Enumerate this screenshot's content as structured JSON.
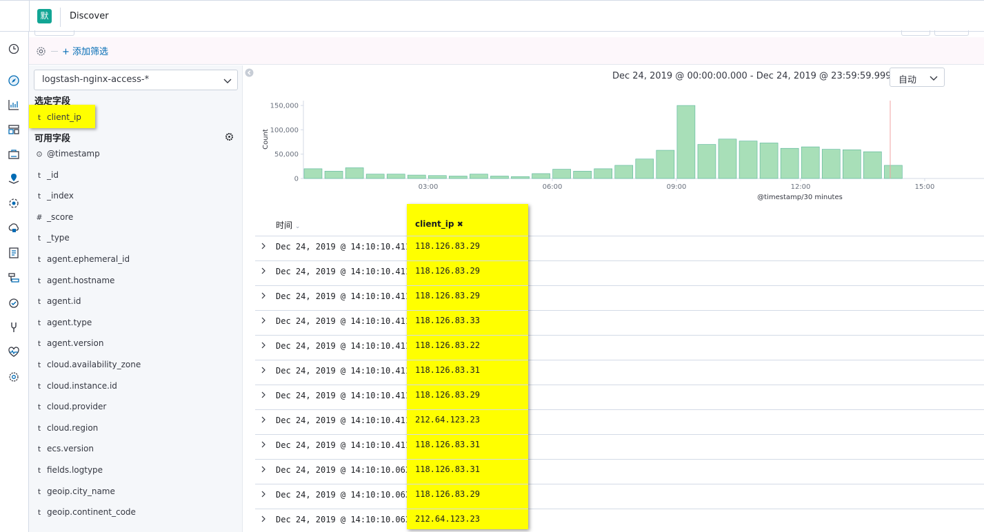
{
  "header": {
    "logo_char": "默",
    "title": "Discover"
  },
  "filter_bar": {
    "add_filter_label": "+ 添加筛选"
  },
  "sidebar": {
    "index_pattern": "logstash-nginx-access-*",
    "selected_title": "选定字段",
    "selected_fields": [
      {
        "type": "t",
        "name": "client_ip"
      }
    ],
    "available_title": "可用字段",
    "available_fields": [
      {
        "type": "⊙",
        "name": "@timestamp"
      },
      {
        "type": "t",
        "name": "_id"
      },
      {
        "type": "t",
        "name": "_index"
      },
      {
        "type": "#",
        "name": "_score"
      },
      {
        "type": "t",
        "name": "_type"
      },
      {
        "type": "t",
        "name": "agent.ephemeral_id"
      },
      {
        "type": "t",
        "name": "agent.hostname"
      },
      {
        "type": "t",
        "name": "agent.id"
      },
      {
        "type": "t",
        "name": "agent.type"
      },
      {
        "type": "t",
        "name": "agent.version"
      },
      {
        "type": "t",
        "name": "cloud.availability_zone"
      },
      {
        "type": "t",
        "name": "cloud.instance.id"
      },
      {
        "type": "t",
        "name": "cloud.provider"
      },
      {
        "type": "t",
        "name": "cloud.region"
      },
      {
        "type": "t",
        "name": "ecs.version"
      },
      {
        "type": "t",
        "name": "fields.logtype"
      },
      {
        "type": "t",
        "name": "geoip.city_name"
      },
      {
        "type": "t",
        "name": "geoip.continent_code"
      }
    ]
  },
  "main": {
    "time_range": "Dec 24, 2019 @ 00:00:00.000 - Dec 24, 2019 @ 23:59:59.999 —",
    "interval": "自动"
  },
  "chart_data": {
    "type": "bar",
    "xlabel": "@timestamp/30 minutes",
    "ylabel": "Count",
    "x_ticks": [
      "03:00",
      "06:00",
      "09:00",
      "12:00",
      "15:00"
    ],
    "y_ticks": [
      "0",
      "50,000",
      "100,000",
      "150,000"
    ],
    "ylim": [
      0,
      160000
    ],
    "x": [
      "00:30",
      "01:00",
      "01:30",
      "02:00",
      "02:30",
      "03:00",
      "03:30",
      "04:00",
      "04:30",
      "05:00",
      "05:30",
      "06:00",
      "06:30",
      "07:00",
      "07:30",
      "08:00",
      "08:30",
      "09:00",
      "09:30",
      "10:00",
      "10:30",
      "11:00",
      "11:30",
      "12:00",
      "12:30",
      "13:00",
      "13:30",
      "14:00"
    ],
    "values": [
      20000,
      15000,
      22000,
      9000,
      9000,
      7000,
      6000,
      5000,
      9000,
      5000,
      4000,
      10000,
      19000,
      15000,
      20000,
      27000,
      40000,
      58000,
      150000,
      70000,
      81000,
      77000,
      73000,
      62000,
      65000,
      60000,
      59000,
      55000,
      27000
    ],
    "bar_color": "#a8dfb8",
    "bar_stroke": "#54b399",
    "now_marker_color": "#f2a1a1",
    "grid": false
  },
  "table": {
    "time_header": "时间",
    "ip_header": "client_ip",
    "rows": [
      {
        "time": "Dec 24, 2019 @ 14:10:10.411",
        "client_ip": "118.126.83.29"
      },
      {
        "time": "Dec 24, 2019 @ 14:10:10.411",
        "client_ip": "118.126.83.29"
      },
      {
        "time": "Dec 24, 2019 @ 14:10:10.411",
        "client_ip": "118.126.83.29"
      },
      {
        "time": "Dec 24, 2019 @ 14:10:10.411",
        "client_ip": "118.126.83.33"
      },
      {
        "time": "Dec 24, 2019 @ 14:10:10.411",
        "client_ip": "118.126.83.22"
      },
      {
        "time": "Dec 24, 2019 @ 14:10:10.411",
        "client_ip": "118.126.83.31"
      },
      {
        "time": "Dec 24, 2019 @ 14:10:10.411",
        "client_ip": "118.126.83.29"
      },
      {
        "time": "Dec 24, 2019 @ 14:10:10.411",
        "client_ip": "212.64.123.23"
      },
      {
        "time": "Dec 24, 2019 @ 14:10:10.411",
        "client_ip": "118.126.83.31"
      },
      {
        "time": "Dec 24, 2019 @ 14:10:10.063",
        "client_ip": "118.126.83.31"
      },
      {
        "time": "Dec 24, 2019 @ 14:10:10.063",
        "client_ip": "118.126.83.29"
      },
      {
        "time": "Dec 24, 2019 @ 14:10:10.063",
        "client_ip": "212.64.123.23"
      }
    ]
  }
}
